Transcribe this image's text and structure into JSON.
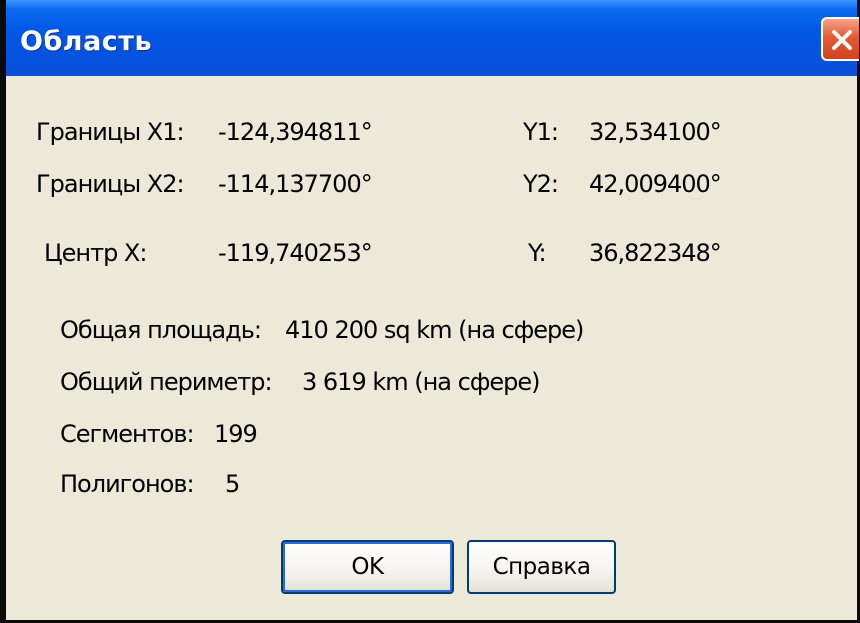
{
  "window": {
    "title": "Область"
  },
  "bounds": {
    "x1_label": "Границы X1:",
    "x1_value": "-124,394811°",
    "y1_label": "Y1:",
    "y1_value": "32,534100°",
    "x2_label": "Границы X2:",
    "x2_value": "-114,137700°",
    "y2_label": "Y2:",
    "y2_value": "42,009400°"
  },
  "center": {
    "x_label": "Центр X:",
    "x_value": "-119,740253°",
    "y_label": "Y:",
    "y_value": "36,822348°"
  },
  "stats": {
    "area_label": "Общая площадь:",
    "area_value": "410 200 sq km (на сфере)",
    "perimeter_label": "Общий периметр:",
    "perimeter_value": "3 619 km (на сфере)",
    "segments_label": "Сегментов:",
    "segments_value": "199",
    "polygons_label": "Полигонов:",
    "polygons_value": "5"
  },
  "buttons": {
    "ok": "OK",
    "help": "Справка"
  },
  "icons": {
    "close": "close-icon"
  },
  "colors": {
    "titlebar": "#0058e6",
    "close": "#e45b33",
    "dialog_bg": "#ece9d8"
  }
}
